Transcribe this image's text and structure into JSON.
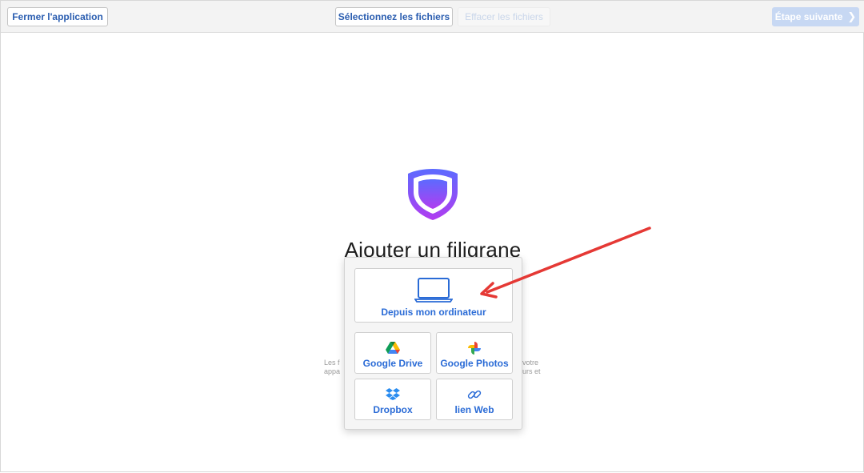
{
  "toolbar": {
    "close_label": "Fermer l'application",
    "select_files_label": "Sélectionnez les fichiers",
    "clear_files_label": "Effacer les fichiers",
    "next_step_label": "Étape suivante",
    "next_step_icon": "chevron-right-icon"
  },
  "main": {
    "logo_icon": "shield-logo-icon",
    "title": "Ajouter un filigrane",
    "description_left": "Les f\nappa",
    "description_right": "votre\nurs et"
  },
  "upload_menu": {
    "computer": {
      "label": "Depuis mon ordinateur",
      "icon": "laptop-icon"
    },
    "google_drive": {
      "label": "Google Drive",
      "icon": "google-drive-icon"
    },
    "google_photos": {
      "label": "Google Photos",
      "icon": "google-photos-icon"
    },
    "dropbox": {
      "label": "Dropbox",
      "icon": "dropbox-icon"
    },
    "web_link": {
      "label": "lien Web",
      "icon": "link-icon"
    }
  },
  "annotation": {
    "color": "#e53935",
    "icon": "red-arrow-annotation"
  },
  "colors": {
    "accent": "#2a6bd6",
    "next_button_disabled": "#c7d8f3",
    "logo_gradient_start": "#6a5cff",
    "logo_gradient_end": "#b340f0"
  }
}
